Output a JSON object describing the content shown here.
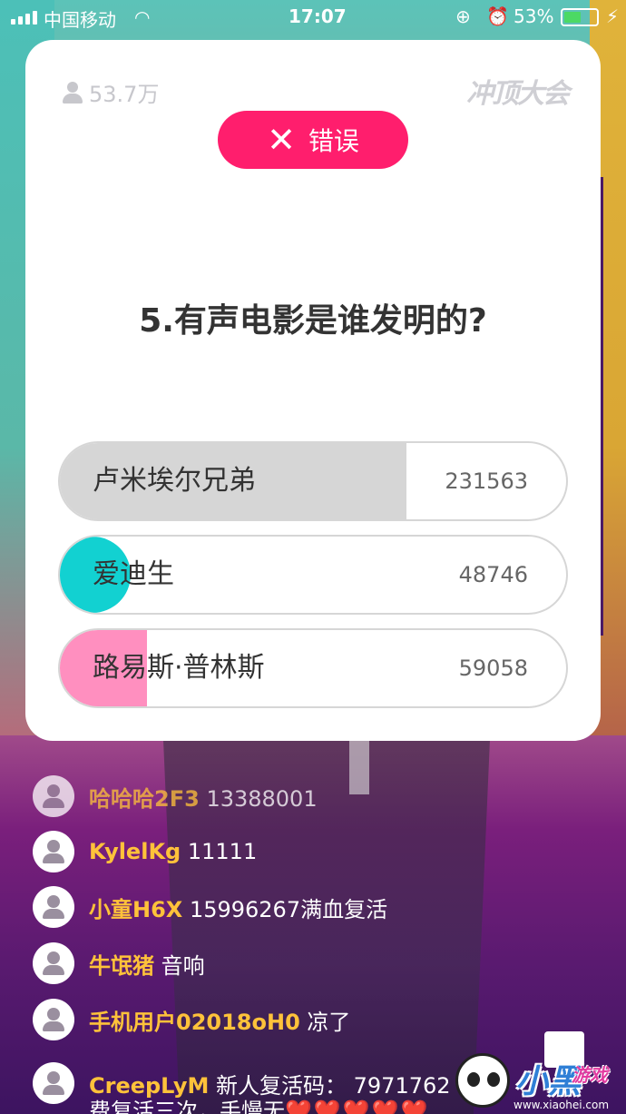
{
  "status_bar": {
    "carrier": "中国移动",
    "time": "17:07",
    "battery_percent": "53%",
    "battery_level": 0.53,
    "icons": [
      "signal-icon",
      "wifi-icon",
      "rotation-lock-icon",
      "alarm-icon",
      "battery-icon",
      "charging-icon"
    ]
  },
  "quiz": {
    "viewer_count": "53.7万",
    "brand": "冲顶大会",
    "result_label": "错误",
    "question": "5.有声电影是谁发明的?",
    "options": [
      {
        "label": "卢米埃尔兄弟",
        "count": "231563"
      },
      {
        "label": "爱迪生",
        "count": "48746"
      },
      {
        "label": "路易斯·普林斯",
        "count": "59058"
      }
    ],
    "colors": {
      "wrong": "#ff1e6d",
      "option_2": "#12d1d1",
      "option_3": "#ff8fbf",
      "option_1": "#d6d6d6"
    }
  },
  "comments": [
    {
      "user": "哈哈哈2F3",
      "message": "13388001"
    },
    {
      "user": "KylelKg",
      "message": "11111"
    },
    {
      "user": "小童H6X",
      "message": "15996267满血复活"
    },
    {
      "user": "牛氓猪",
      "message": "音响"
    },
    {
      "user": "手机用户02018oH0",
      "message": "凉了"
    },
    {
      "user": "CreepLyM",
      "message": "新人复活码： 7971762",
      "message_line2": "费复活三次，手慢无",
      "hearts": "❤️❤️❤️❤️❤️"
    }
  ],
  "watermark": {
    "title": "小黑",
    "subtitle": "游戏",
    "url": "www.xiaohei.com"
  }
}
